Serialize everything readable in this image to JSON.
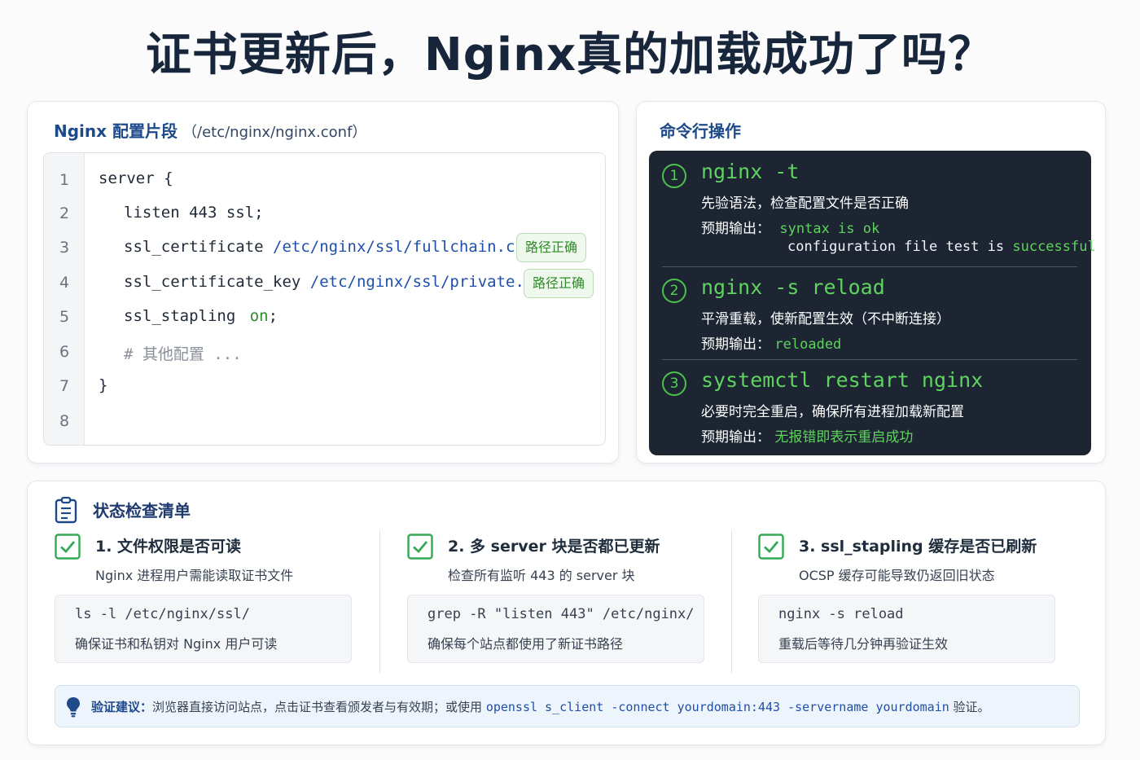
{
  "title": "证书更新后，Nginx真的加载成功了吗？",
  "config_card": {
    "title": "Nginx 配置片段",
    "path": "（/etc/nginx/nginx.conf）",
    "line_numbers": [
      "1",
      "2",
      "3",
      "4",
      "5",
      "6",
      "7",
      "8"
    ],
    "lines": {
      "l1": "server {",
      "l2": "listen 443 ssl;",
      "l3_key": "ssl_certificate",
      "l3_val": "/etc/nginx/ssl/fullchain.crt",
      "l3_end": ";",
      "l4_key": "ssl_certificate_key",
      "l4_val": "/etc/nginx/ssl/private.key",
      "l4_end": ";",
      "l5_key": "ssl_stapling",
      "l5_val": "on",
      "l5_end": ";",
      "l6": "# 其他配置 ...",
      "l7": "}"
    },
    "badge_l3": "路径正确",
    "badge_l4": "路径正确"
  },
  "cmd_card": {
    "title": "命令行操作",
    "steps": [
      {
        "num": "1",
        "cmd": "nginx -t",
        "desc": "先验语法，检查配置文件是否正确",
        "out_label": "预期输出：",
        "out_line1": "syntax is ok",
        "out_line2_a": "configuration file test is",
        "out_line2_b": "successful"
      },
      {
        "num": "2",
        "cmd": "nginx -s reload",
        "desc": "平滑重载，使新配置生效（不中断连接）",
        "out_label": "预期输出：",
        "out_line1": "reloaded"
      },
      {
        "num": "3",
        "cmd": "systemctl restart nginx",
        "desc": "必要时完全重启，确保所有进程加载新配置",
        "out_label": "预期输出：",
        "out_line1": "无报错即表示重启成功"
      }
    ]
  },
  "checklist": {
    "title": "状态检查清单",
    "items": [
      {
        "title": "1. 文件权限是否可读",
        "sub": "Nginx 进程用户需能读取证书文件",
        "cmd": "ls -l /etc/nginx/ssl/",
        "note": "确保证书和私钥对 Nginx 用户可读"
      },
      {
        "title": "2. 多 server 块是否都已更新",
        "sub": "检查所有监听 443 的 server 块",
        "cmd": "grep -R \"listen 443\" /etc/nginx/",
        "note": "确保每个站点都使用了新证书路径"
      },
      {
        "title": "3. ssl_stapling 缓存是否已刷新",
        "sub": "OCSP 缓存可能导致仍返回旧状态",
        "cmd": "nginx -s reload",
        "note": "重载后等待几分钟再验证生效"
      }
    ],
    "tip": {
      "label": "验证建议：",
      "text": "浏览器直接访问站点，点击证书查看颁发者与有效期；或使用",
      "code": "openssl s_client -connect yourdomain:443 -servername yourdomain",
      "end": "验证。"
    }
  },
  "colors": {
    "accent": "#1e4a8a",
    "terminal_bg": "#1c2531",
    "terminal_green": "#5fd35f",
    "badge_green": "#2f8a2a"
  }
}
